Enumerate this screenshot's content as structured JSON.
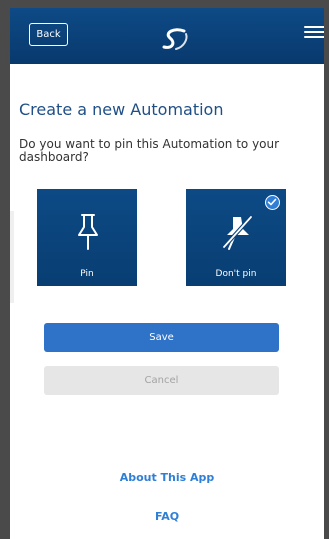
{
  "header": {
    "back_label": "Back",
    "logo_icon": "swirl-logo-icon",
    "menu_icon": "hamburger-menu-icon"
  },
  "main": {
    "title": "Create a new Automation",
    "question": "Do you want to pin this Automation to your dashboard?",
    "options": [
      {
        "label": "Pin",
        "icon": "pin-icon",
        "selected": false
      },
      {
        "label": "Don't pin",
        "icon": "unpin-icon",
        "selected": true
      }
    ],
    "save_label": "Save",
    "cancel_label": "Cancel"
  },
  "footer": {
    "about_label": "About This App",
    "faq_label": "FAQ"
  },
  "colors": {
    "header_bg": "#0a4178",
    "title_text": "#1f4f86",
    "primary_button": "#2f73c8",
    "link": "#2f7fd6",
    "disabled_button": "#e6e6e6"
  }
}
